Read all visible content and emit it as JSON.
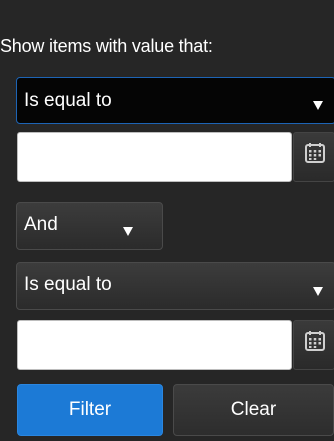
{
  "filter_menu": {
    "info_text": "Show items with value that:",
    "first_operator": {
      "selected": "Is equal to",
      "icon": "chevron-down-icon"
    },
    "first_value": {
      "value": "",
      "picker_icon": "calendar-icon"
    },
    "logic": {
      "selected": "And",
      "icon": "chevron-down-icon"
    },
    "second_operator": {
      "selected": "Is equal to",
      "icon": "chevron-down-icon"
    },
    "second_value": {
      "value": "",
      "picker_icon": "calendar-icon"
    },
    "buttons": {
      "filter_label": "Filter",
      "clear_label": "Clear"
    },
    "colors": {
      "background": "#262626",
      "primary_button": "#1c7ad6",
      "focus_border": "#1d64b5"
    }
  }
}
